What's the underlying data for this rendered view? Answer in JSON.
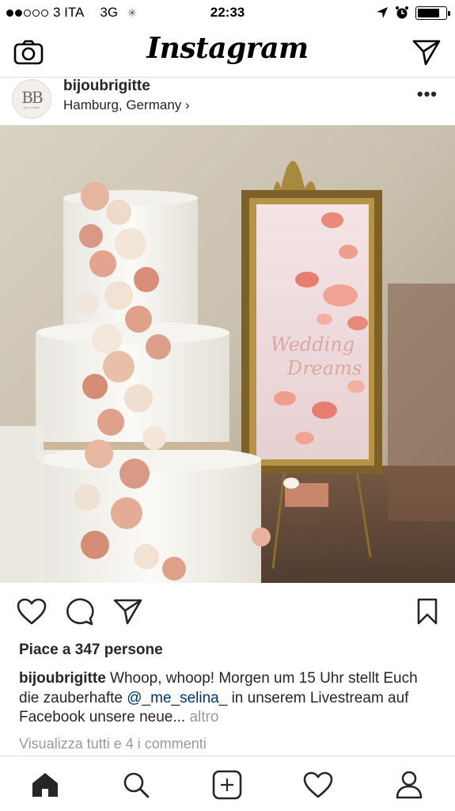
{
  "status_bar": {
    "carrier": "3 ITA",
    "network": "3G",
    "time": "22:33"
  },
  "header": {
    "title": "Instagram",
    "left_icon": "camera-icon",
    "right_icon": "direct-send-icon"
  },
  "post": {
    "username": "bijoubrigitte",
    "location": "Hamburg, Germany ›",
    "avatar_monogram": "BB",
    "avatar_subtext": "bijou brigitte",
    "more_icon": "•••",
    "photo": {
      "description_sign_text_1": "Wedding",
      "description_sign_text_2": "Dreams"
    },
    "likes": "Piace a 347 persone",
    "caption": {
      "user": "bijoubrigitte",
      "text_1": " Whoop, whoop! Morgen um 15 Uhr stellt Euch die zauberhafte ",
      "mention": "@_me_selina_",
      "text_2": " in unserem Livestream auf Facebook unsere neue...",
      "more": " altro"
    },
    "comments_link": "Visualizza tutti e 4 i commenti"
  },
  "tab_bar": {
    "items": [
      "home-icon",
      "search-icon",
      "add-post-icon",
      "activity-heart-icon",
      "profile-icon"
    ]
  },
  "colors": {
    "text": "#262626",
    "muted": "#999999",
    "link": "#003569",
    "border": "#dbdbdb"
  }
}
